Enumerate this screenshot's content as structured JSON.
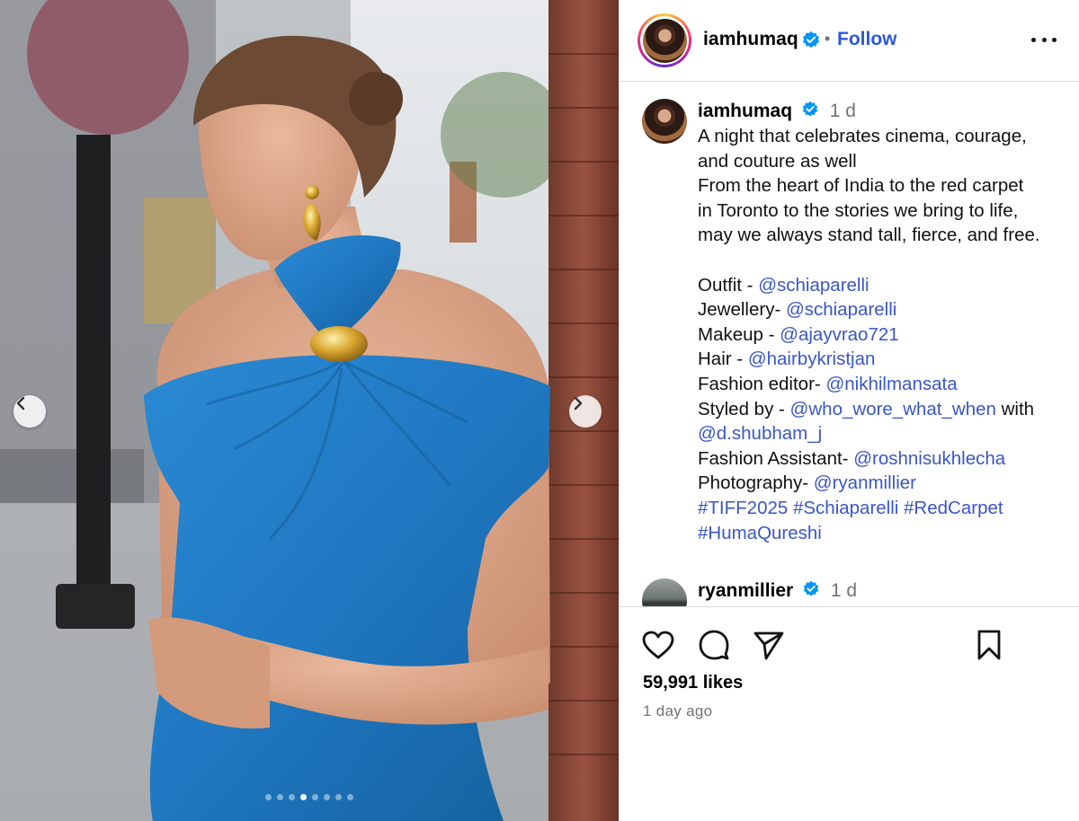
{
  "post": {
    "author": "iamhumaq",
    "follow_label": "Follow",
    "separator": "•",
    "menu_icon": "more-horizontal-icon"
  },
  "carousel": {
    "total_slides": 8,
    "current_slide": 4
  },
  "caption_comment": {
    "username": "iamhumaq",
    "time": "1 d",
    "lines": [
      {
        "text": "A night that celebrates cinema, courage,"
      },
      {
        "text": "and couture as well"
      },
      {
        "text": "From the heart of India to the red carpet"
      },
      {
        "text": "in Toronto to the stories we bring to life,"
      },
      {
        "text": "may we always stand tall, fierce, and free."
      }
    ],
    "credits": [
      {
        "label": "Outfit - ",
        "handle": "@schiaparelli"
      },
      {
        "label": "Jewellery- ",
        "handle": "@schiaparelli"
      },
      {
        "label": "Makeup - ",
        "handle": "@ajayvrao721"
      },
      {
        "label": "Hair - ",
        "handle": "@hairbykristjan"
      },
      {
        "label": "Fashion editor- ",
        "handle": "@nikhilmansata"
      },
      {
        "label": "Styled by - ",
        "handle": "@who_wore_what_when",
        "suffix": " with"
      },
      {
        "label": "",
        "handle": "@d.shubham_j"
      },
      {
        "label": "Fashion Assistant- ",
        "handle": "@roshnisukhlecha"
      },
      {
        "label": "Photography- ",
        "handle": "@ryanmillier"
      }
    ],
    "hashtags_line1": "#TIFF2025 #Schiaparelli #RedCarpet",
    "hashtags_line2": "#HumaQureshi"
  },
  "next_comment": {
    "username": "ryanmillier",
    "time": "1 d"
  },
  "actions": {
    "like_icon": "heart-icon",
    "comment_icon": "comment-icon",
    "share_icon": "send-icon",
    "save_icon": "bookmark-icon"
  },
  "likes_text": "59,991 likes",
  "posted_ago": "1 day ago",
  "colors": {
    "link": "#3a56c8",
    "follow": "#2f57d8",
    "verified": "#0095f6",
    "dress": "#1f78c1"
  }
}
